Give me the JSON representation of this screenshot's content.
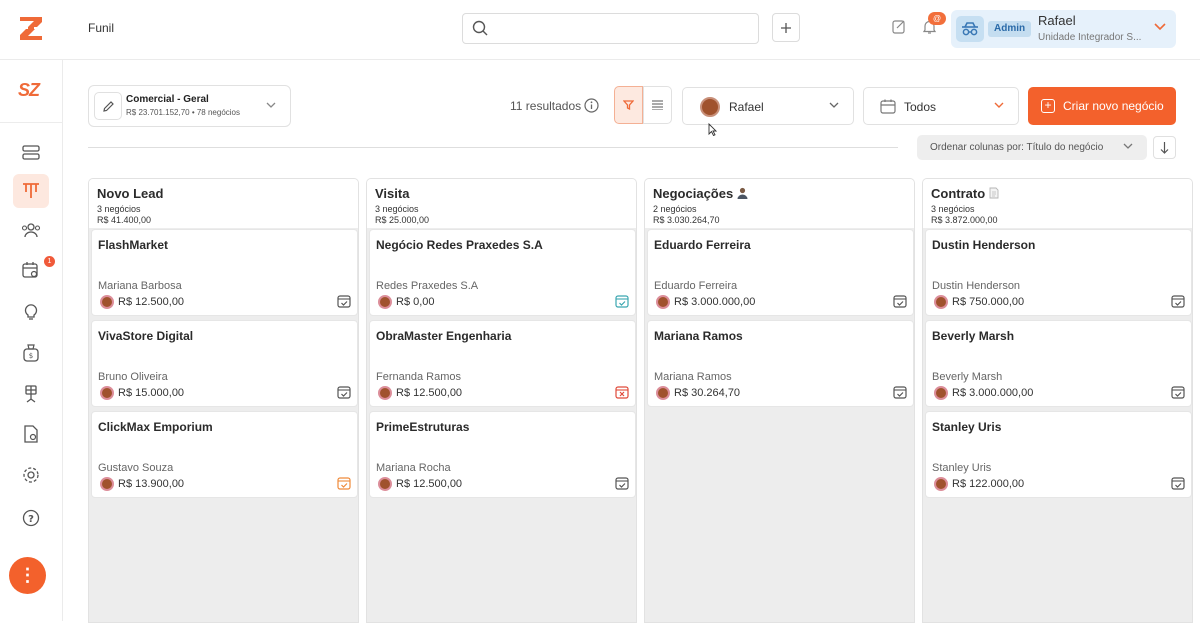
{
  "header": {
    "breadcrumb": "Funil",
    "notification_count": "@",
    "user": {
      "role": "Admin",
      "name": "Rafael",
      "unit": "Unidade Integrador S..."
    }
  },
  "sidebar": {
    "brand": "SZ",
    "items": [
      {
        "icon": "server-icon"
      },
      {
        "icon": "funnel-icon",
        "active": true
      },
      {
        "icon": "users-icon"
      },
      {
        "icon": "calendar-search-icon",
        "badge": "1"
      },
      {
        "icon": "lightbulb-icon"
      },
      {
        "icon": "money-bag-icon"
      },
      {
        "icon": "solar-panel-icon"
      },
      {
        "icon": "document-settings-icon"
      },
      {
        "icon": "gear-icon"
      },
      {
        "icon": "help-icon"
      }
    ],
    "fab": "⋮"
  },
  "toolbar": {
    "pipeline_title": "Comercial - Geral",
    "pipeline_summary": "R$ 23.701.152,70 • 78 negócios",
    "results": "11 resultados",
    "owner": "Rafael",
    "date_filter": "Todos",
    "create_label": "Criar novo negócio",
    "sort_label": "Ordenar colunas por: Título do negócio"
  },
  "colors": {
    "accent": "#f3612c",
    "accent_light": "#fde8df",
    "user_bg": "#e6f1fb"
  },
  "columns": [
    {
      "title": "Novo Lead",
      "icon": "",
      "count": "3 negócios",
      "total": "R$ 41.400,00",
      "cards": [
        {
          "company": "FlashMarket",
          "person": "Mariana Barbosa",
          "value": "R$ 12.500,00",
          "status": "gray"
        },
        {
          "company": "VivaStore Digital",
          "person": "Bruno Oliveira",
          "value": "R$ 15.000,00",
          "status": "gray"
        },
        {
          "company": "ClickMax Emporium",
          "person": "Gustavo Souza",
          "value": "R$ 13.900,00",
          "status": "orange"
        }
      ]
    },
    {
      "title": "Visita",
      "icon": "",
      "count": "3 negócios",
      "total": "R$ 25.000,00",
      "cards": [
        {
          "company": "Negócio Redes Praxedes S.A",
          "person": "Redes Praxedes S.A",
          "value": "R$ 0,00",
          "status": "teal"
        },
        {
          "company": "ObraMaster Engenharia",
          "person": "Fernanda Ramos",
          "value": "R$ 12.500,00",
          "status": "red"
        },
        {
          "company": "PrimeEstruturas",
          "person": "Mariana Rocha",
          "value": "R$ 12.500,00",
          "status": "gray"
        }
      ]
    },
    {
      "title": "Negociações",
      "icon": "person",
      "count": "2 negócios",
      "total": "R$ 3.030.264,70",
      "cards": [
        {
          "company": "Eduardo Ferreira",
          "person": "Eduardo Ferreira",
          "value": "R$ 3.000.000,00",
          "status": "gray"
        },
        {
          "company": "Mariana Ramos",
          "person": "Mariana Ramos",
          "value": "R$ 30.264,70",
          "status": "gray"
        }
      ]
    },
    {
      "title": "Contrato",
      "icon": "doc",
      "count": "3 negócios",
      "total": "R$ 3.872.000,00",
      "cards": [
        {
          "company": "Dustin Henderson",
          "person": "Dustin Henderson",
          "value": "R$ 750.000,00",
          "status": "gray"
        },
        {
          "company": "Beverly Marsh",
          "person": "Beverly Marsh",
          "value": "R$ 3.000.000,00",
          "status": "gray"
        },
        {
          "company": "Stanley Uris",
          "person": "Stanley Uris",
          "value": "R$ 122.000,00",
          "status": "gray"
        }
      ]
    }
  ]
}
